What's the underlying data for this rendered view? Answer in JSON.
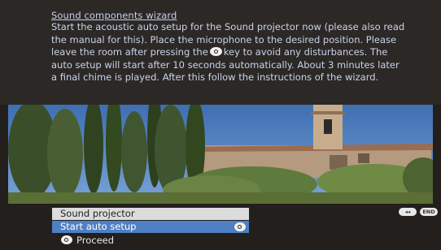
{
  "wizard": {
    "title": "Sound components wizard",
    "body": [
      "Start the acoustic auto setup for the Sound projector now (please also read",
      "the manual for this). Place the microphone to the desired position. Please",
      [
        "leave the room after pressing the",
        "key to avoid any disturbances. The"
      ],
      "auto setup will start after 10 seconds automatically. About 3 minutes later",
      "a final chime is played. After this follow the instructions of the wizard."
    ],
    "line1": "Start the acoustic auto setup for the Sound projector now (please also read",
    "line2": "the manual for this). Place the microphone to the desired position. Please",
    "line3a": "leave the room after pressing the",
    "line3b": "key to avoid any disturbances. The",
    "line4": "auto setup will start after 10 seconds automatically. About 3 minutes later",
    "line5": "a final chime is played. After this follow the instructions of the wizard."
  },
  "menu": {
    "header": "Sound projector",
    "selected_item": "Start auto setup",
    "proceed_label": "Proceed"
  },
  "nav": {
    "end_label": "END"
  },
  "colors": {
    "top_panel": "#2c2825",
    "menu_selected": "#4f7fc4",
    "menu_header": "#dcdcdc",
    "text": "#c8d4ea"
  },
  "icons": [
    "ok-icon",
    "rewind-icon",
    "end-icon"
  ]
}
